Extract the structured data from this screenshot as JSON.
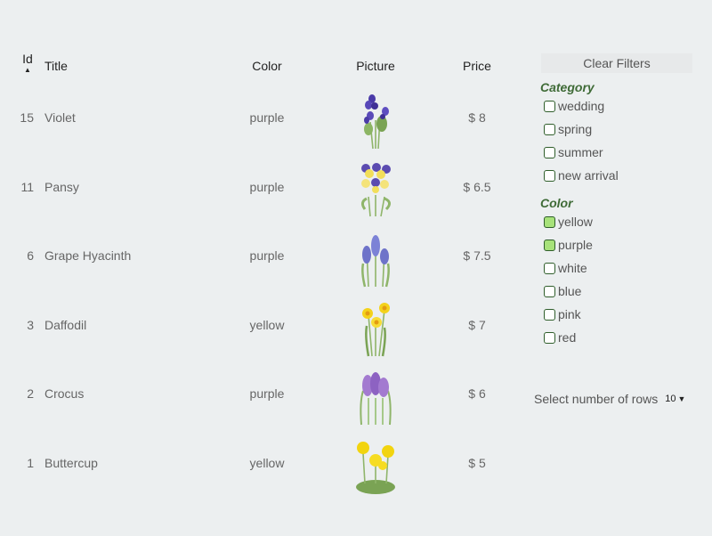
{
  "table": {
    "headers": {
      "id": "Id",
      "title": "Title",
      "color": "Color",
      "picture": "Picture",
      "price": "Price"
    },
    "sort_indicator": "▲",
    "rows": [
      {
        "id": "15",
        "title": "Violet",
        "color": "purple",
        "price": "$ 8",
        "picture": "violet-flower"
      },
      {
        "id": "11",
        "title": "Pansy",
        "color": "purple",
        "price": "$ 6.5",
        "picture": "pansy-flower"
      },
      {
        "id": "6",
        "title": "Grape Hyacinth",
        "color": "purple",
        "price": "$ 7.5",
        "picture": "grape-hyacinth-flower"
      },
      {
        "id": "3",
        "title": "Daffodil",
        "color": "yellow",
        "price": "$ 7",
        "picture": "daffodil-flower"
      },
      {
        "id": "2",
        "title": "Crocus",
        "color": "purple",
        "price": "$ 6",
        "picture": "crocus-flower"
      },
      {
        "id": "1",
        "title": "Buttercup",
        "color": "yellow",
        "price": "$ 5",
        "picture": "buttercup-flower"
      }
    ]
  },
  "filters": {
    "clear_label": "Clear Filters",
    "category_title": "Category",
    "categories": [
      {
        "label": "wedding",
        "checked": false
      },
      {
        "label": "spring",
        "checked": false
      },
      {
        "label": "summer",
        "checked": false
      },
      {
        "label": "new arrival",
        "checked": false
      }
    ],
    "color_title": "Color",
    "colors": [
      {
        "label": "yellow",
        "checked": true
      },
      {
        "label": "purple",
        "checked": true
      },
      {
        "label": "white",
        "checked": false
      },
      {
        "label": "blue",
        "checked": false
      },
      {
        "label": "pink",
        "checked": false
      },
      {
        "label": "red",
        "checked": false
      }
    ]
  },
  "pagination": {
    "rows_label": "Select number of rows",
    "rows_value": "10"
  },
  "theme": {
    "background": "#eceff0",
    "accent_green": "#3f6b37",
    "checked_fill": "#a7e27a"
  }
}
